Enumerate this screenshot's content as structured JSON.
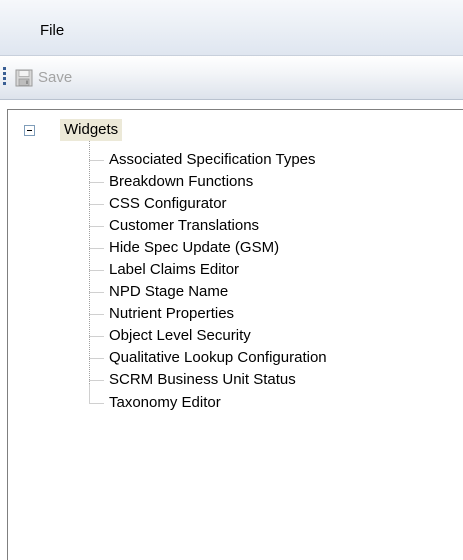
{
  "menubar": {
    "file_label": "File"
  },
  "toolbar": {
    "save_label": "Save",
    "save_icon": "floppy-disk-icon"
  },
  "tree": {
    "root_label": "Widgets",
    "items": [
      "Associated Specification Types",
      "Breakdown Functions",
      "CSS Configurator",
      "Customer Translations",
      "Hide Spec Update (GSM)",
      "Label Claims Editor",
      "NPD Stage Name",
      "Nutrient Properties",
      "Object Level Security",
      "Qualitative Lookup Configuration",
      "SCRM Business Unit Status",
      "Taxonomy Editor"
    ]
  },
  "colors": {
    "root_highlight": "#ece9d8",
    "disabled_text": "#a3a3a3",
    "grip": "#3a5f94"
  }
}
